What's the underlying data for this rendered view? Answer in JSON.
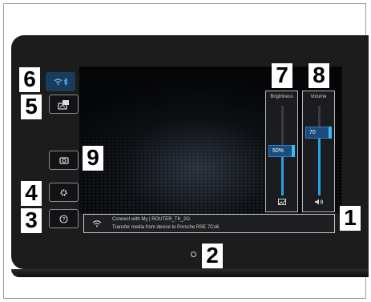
{
  "side_menu": {
    "connectivity_active": true,
    "callouts": [
      "6",
      "5",
      "9",
      "4",
      "3"
    ],
    "icons": {
      "connectivity": "wifi-bluetooth-icon",
      "media_transfer": "media-transfer-icon",
      "camera": "camera-icon",
      "settings": "gear-icon",
      "help": "help-icon"
    }
  },
  "brightness": {
    "title": "Brightness",
    "value_label": "50%",
    "level": 0.5,
    "icon": "brightness-image-icon",
    "callout": "7"
  },
  "volume": {
    "title": "Volume",
    "value_label": "70",
    "level": 0.7,
    "icon": "speaker-icon",
    "callout": "8"
  },
  "notification": {
    "icon": "wifi-icon",
    "line1": "Connect with My | ROUTER_TK_2G.",
    "line2": "Transfer media from device to Porsche RSE 7Co6",
    "callout": "1"
  },
  "home": {
    "icon": "home-circle-icon",
    "callout": "2"
  },
  "colors": {
    "accent": "#23a3e4",
    "active_button": "#1b3b5a",
    "bezel": "#1c1c1d"
  }
}
